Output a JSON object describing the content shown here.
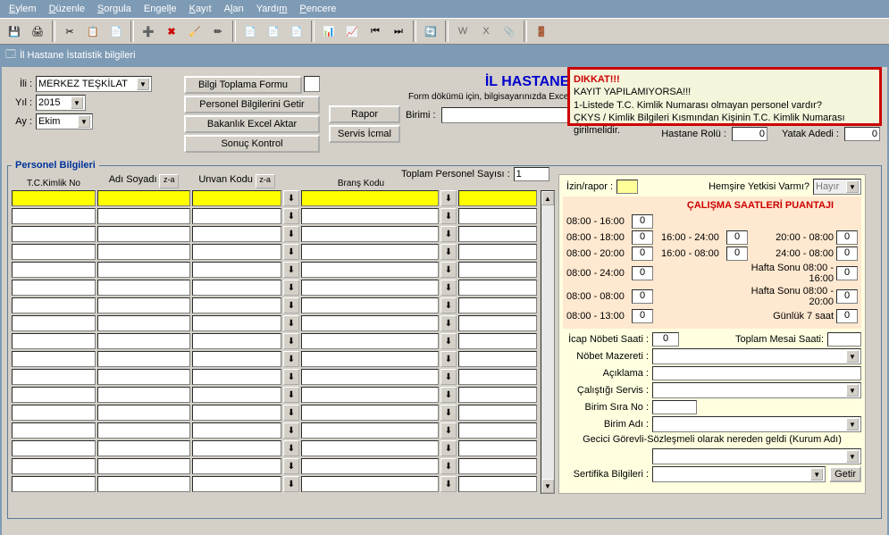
{
  "menu": [
    "Eylem",
    "Düzenle",
    "Sorgula",
    "Engelle",
    "Kayıt",
    "Alan",
    "Yardım",
    "Pencere"
  ],
  "window_title": "İl Hastane İstatistik bilgileri",
  "title": "İL HASTANE İSTATİSTİK BİLGİLERİ",
  "subtitle": "Form dökümü için, bilgisayarınızda Excel yüklü ve açılır pencere engelleyicisi ayarı kapalı olmalıdır.",
  "filters": {
    "il_label": "İli :",
    "il_value": "MERKEZ TEŞKİLAT",
    "yil_label": "Yıl :",
    "yil_value": "2015",
    "ay_label": "Ay :",
    "ay_value": "Ekim"
  },
  "buttons": {
    "bilgi_toplama": "Bilgi Toplama Formu",
    "personel_getir": "Personel Bilgilerini Getir",
    "bakanlik_excel": "Bakanlık Excel Aktar",
    "sonuc_kontrol": "Sonuç Kontrol",
    "rapor": "Rapor",
    "servis_icmal": "Servis İcmal",
    "getir": "Getir"
  },
  "birimi_label": "Birimi :",
  "hastane_rolu_label": "Hastane Rolü :",
  "hastane_rolu_value": "0",
  "yatak_adedi_label": "Yatak Adedi :",
  "yatak_adedi_value": "0",
  "warning": {
    "title": "DIKKAT!!!",
    "line1": "KAYIT YAPILAMIYORSA!!!",
    "line2": "1-Listede T.C. Kimlik Numarası olmayan personel vardır?",
    "line3": "ÇKYS / Kimlik Bilgileri Kısmından Kişinin T.C. Kimlik Numarası girilmelidir."
  },
  "fieldset_title": "Personel Bilgileri",
  "toplam_personel_label": "Toplam Personel Sayısı :",
  "toplam_personel_value": "1",
  "grid_headers": {
    "tc": "T.C.Kimlik No",
    "ad": "Adı Soyadı",
    "unvan": "Unvan Kodu",
    "brans": "Branş Kodu",
    "sort": "z-a"
  },
  "izin_rapor_label": "İzin/rapor :",
  "hemsire_label": "Hemşire Yetkisi Varmı?",
  "hemsire_value": "Hayır",
  "shifts": {
    "title": "ÇALIŞMA SAATLERİ PUANTAJI",
    "rows": [
      {
        "l1": "08:00 - 16:00",
        "v1": "0"
      },
      {
        "l1": "08:00 - 18:00",
        "v1": "0",
        "l2": "16:00 - 24:00",
        "v2": "0",
        "l3": "20:00 - 08:00",
        "v3": "0"
      },
      {
        "l1": "08:00 - 20:00",
        "v1": "0",
        "l2": "16:00 - 08:00",
        "v2": "0",
        "l3": "24:00 - 08:00",
        "v3": "0"
      },
      {
        "l1": "08:00 - 24:00",
        "v1": "0",
        "l3": "Hafta Sonu 08:00 - 16:00",
        "v3": "0"
      },
      {
        "l1": "08:00 - 08:00",
        "v1": "0",
        "l3": "Hafta Sonu 08:00 - 20:00",
        "v3": "0"
      },
      {
        "l1": "08:00 - 13:00",
        "v1": "0",
        "l3": "Günlük 7 saat",
        "v3": "0"
      }
    ]
  },
  "right_fields": {
    "icap_nobeti": "İcap Nöbeti Saati :",
    "icap_nobeti_v": "0",
    "toplam_mesai": "Toplam Mesai Saati:",
    "nobet_mazereti": "Nöbet Mazereti :",
    "aciklama": "Açıklama :",
    "calistigi_servis": "Çalıştığı Servis :",
    "birim_sira": "Birim Sıra No :",
    "birim_adi": "Birim Adı :",
    "gecici": "Gecici Görevli-Sözleşmeli olarak nereden geldi (Kurum Adı)",
    "sertifika": "Sertifika Bilgileri :"
  }
}
